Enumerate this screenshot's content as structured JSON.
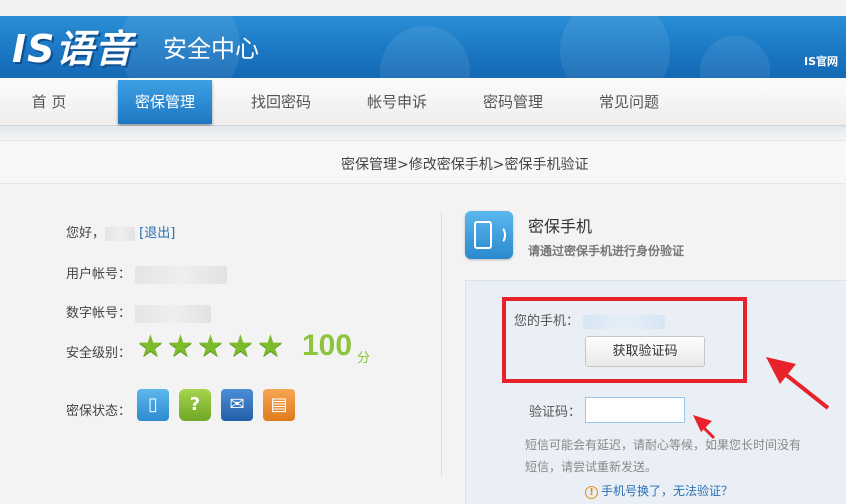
{
  "header": {
    "logo": "IS语音",
    "site_name": "安全中心",
    "official_link": "IS官网"
  },
  "nav": {
    "items": [
      {
        "label": "首 页",
        "active": false
      },
      {
        "label": "密保管理",
        "active": true
      },
      {
        "label": "找回密码",
        "active": false
      },
      {
        "label": "帐号申诉",
        "active": false
      },
      {
        "label": "密码管理",
        "active": false
      },
      {
        "label": "常见问题",
        "active": false
      }
    ]
  },
  "breadcrumb": "密保管理>修改密保手机>密保手机验证",
  "account": {
    "greeting": "您好，",
    "logout": "[退出]",
    "user_account_label": "用户帐号：",
    "numeric_account_label": "数字帐号：",
    "security_level_label": "安全级别：",
    "stars": 5,
    "score": "100",
    "score_unit": "分",
    "protection_status_label": "密保状态："
  },
  "status_icons": [
    "phone-icon",
    "question-icon",
    "mail-icon",
    "card-icon"
  ],
  "mobile": {
    "title": "密保手机",
    "subtitle": "请通过密保手机进行身份验证",
    "phone_label": "您的手机：",
    "get_code_button": "获取验证码",
    "code_label": "验证码：",
    "code_value": "",
    "hint_line1": "短信可能会有延迟，请耐心等候，如果您长时间没有",
    "hint_line2": "短信，请尝试重新发送。",
    "changed_link": "手机号换了，无法验证？"
  },
  "colors": {
    "header_blue": "#1b78c4",
    "accent_green": "#8cc43c",
    "highlight_red": "#e8222a",
    "link_blue": "#2a6fb5"
  }
}
